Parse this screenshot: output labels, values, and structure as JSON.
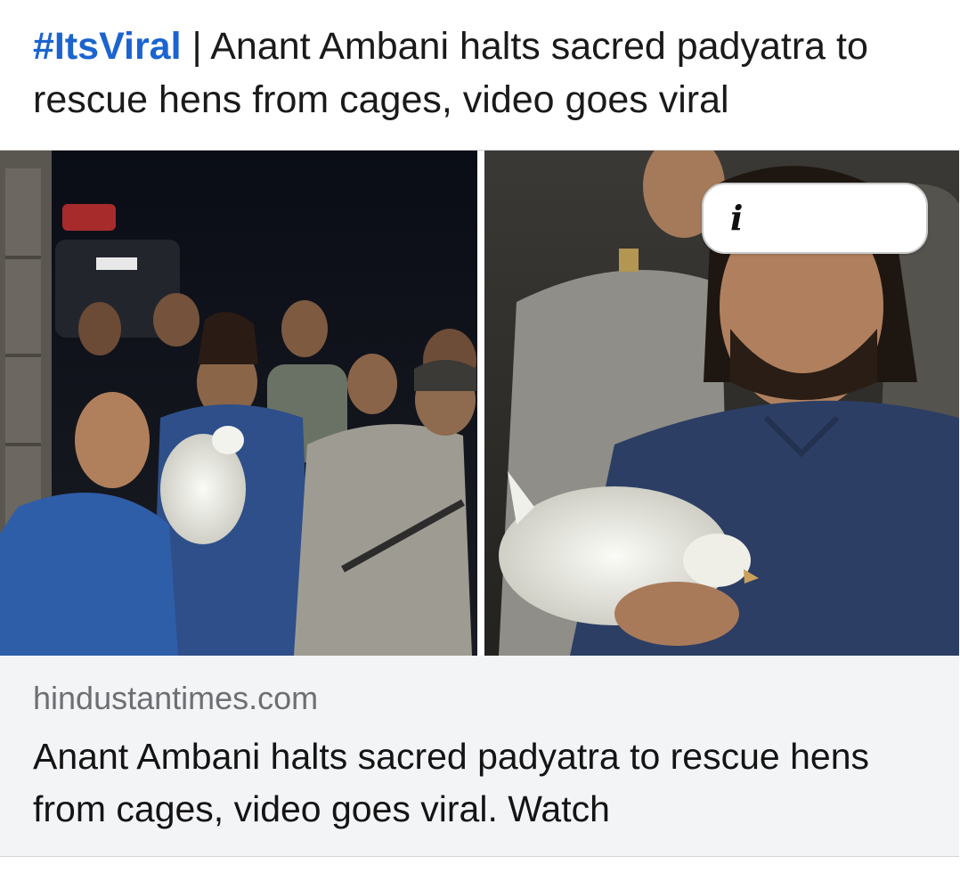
{
  "post": {
    "hashtag": "#ItsViral",
    "separator": " | ",
    "text": "Anant Ambani halts sacred padyatra to rescue hens from cages, video goes viral"
  },
  "link_card": {
    "info_icon": "info-icon",
    "domain": "hindustantimes.com",
    "headline": "Anant Ambani halts sacred padyatra to rescue hens from cages, video goes viral. Watch"
  },
  "colors": {
    "hashtag": "#1b64d0",
    "card_background": "#f3f4f6",
    "domain_text": "#6d6f73"
  }
}
